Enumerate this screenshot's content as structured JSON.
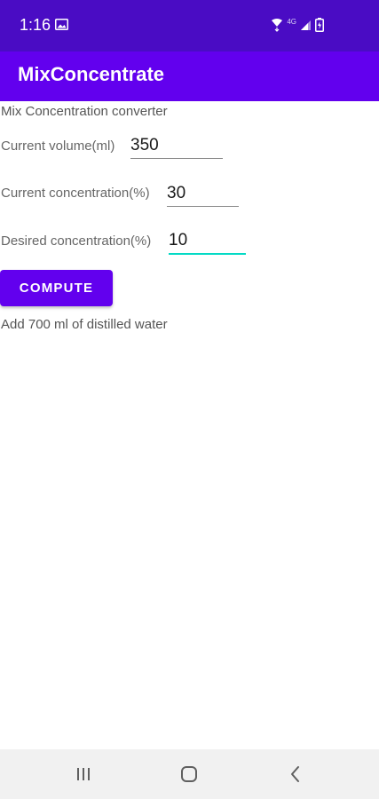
{
  "status_bar": {
    "time": "1:16",
    "network_label": "4G",
    "background": "#4a0cc4",
    "icons": [
      "gallery-icon",
      "wifi-icon",
      "signal-icon",
      "battery-icon"
    ]
  },
  "app_bar": {
    "title": "MixConcentrate",
    "background": "#6200ee"
  },
  "main": {
    "subtitle": "Mix Concentration converter",
    "fields": [
      {
        "label": "Current volume(ml)",
        "value": "350"
      },
      {
        "label": "Current concentration(%)",
        "value": "30"
      },
      {
        "label": "Desired concentration(%)",
        "value": "10"
      }
    ],
    "compute_label": "COMPUTE",
    "result": "Add 700 ml of distilled water",
    "accent": "#03dac5",
    "primary": "#6200ee"
  },
  "nav_bar": {
    "icons": [
      "recent-apps-icon",
      "home-icon",
      "back-icon"
    ],
    "background": "#f1f1f1"
  }
}
